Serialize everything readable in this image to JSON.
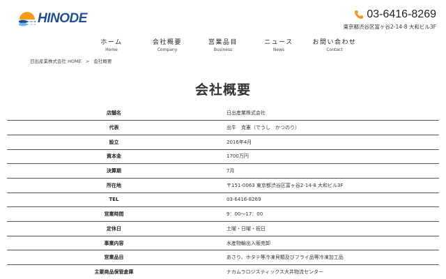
{
  "brand": {
    "name": "HINODE",
    "colors": {
      "navy": "#1f4f8f",
      "sun_orange": "#f39a1c",
      "wave_blue": "#6fb7e6"
    }
  },
  "contact": {
    "phone_icon": "phone-icon",
    "phone": "03-6416-8269",
    "address": "東京都渋谷区富ヶ谷2-14-8 大和ビル3F"
  },
  "nav": {
    "items": [
      {
        "jp": "ホーム",
        "en": "Home"
      },
      {
        "jp": "会社概要",
        "en": "Company"
      },
      {
        "jp": "営業品目",
        "en": "Business"
      },
      {
        "jp": "ニュース",
        "en": "News"
      },
      {
        "jp": "お問い合わせ",
        "en": "Contact"
      }
    ]
  },
  "breadcrumb": {
    "home": "日出産業株式会社 HOME",
    "separator": ">",
    "current": "会社概要"
  },
  "page": {
    "title": "会社概要"
  },
  "table": {
    "rows": [
      {
        "key": "店舗名",
        "value": "日出産業株式会社"
      },
      {
        "key": "代表",
        "value": "出牛　克憲（でうし　かつのり）"
      },
      {
        "key": "設立",
        "value": "2016年4月"
      },
      {
        "key": "資本金",
        "value": "1700万円"
      },
      {
        "key": "決算期",
        "value": "7月"
      },
      {
        "key": "所在地",
        "value": "〒151-0063 東京都渋谷区富ヶ谷2-14-8 大和ビル3F"
      },
      {
        "key": "TEL",
        "value": "03-6416-8269"
      },
      {
        "key": "営業時間",
        "value": "9：00〜17：00"
      },
      {
        "key": "定休日",
        "value": "土曜・日曜・祝日"
      },
      {
        "key": "事業内容",
        "value": "水産物輸出入販売卸"
      },
      {
        "key": "営業品目",
        "value": "あさり、ホタテ等冷凍貝類及びフライ品等冷凍加工品"
      },
      {
        "key": "主要商品保管倉庫",
        "value": "ナカムラロジスティックス大井物流センター"
      }
    ]
  }
}
